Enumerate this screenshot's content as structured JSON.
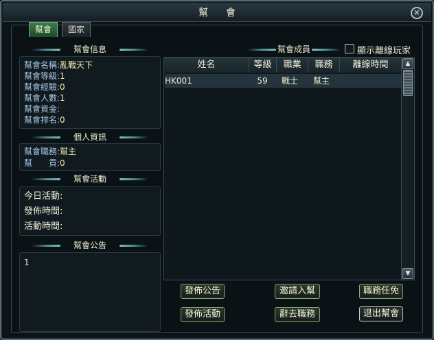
{
  "window": {
    "title": "幫會",
    "close_glyph": "✕"
  },
  "tabs": [
    {
      "label": "幫會",
      "active": true
    },
    {
      "label": "國家",
      "active": false
    }
  ],
  "guild_info": {
    "header": "幫會信息",
    "lines": [
      {
        "label": "幫會名稱:",
        "value": "亂戰天下"
      },
      {
        "label": "幫會等級:",
        "value": "1"
      },
      {
        "label": "幫會經驗:",
        "value": "0"
      },
      {
        "label": "幫會人數:",
        "value": "1"
      },
      {
        "label": "幫會資金:",
        "value": ""
      },
      {
        "label": "幫會排名:",
        "value": "0"
      }
    ]
  },
  "personal_info": {
    "header": "個人資訊",
    "lines": [
      {
        "label": "幫會職務:",
        "value": "幫主"
      },
      {
        "label": "幫　　貢:",
        "value": "0"
      }
    ]
  },
  "activity": {
    "header": "幫會活動",
    "lines": [
      {
        "label": "今日活動:"
      },
      {
        "label": "發佈時間:"
      },
      {
        "label": "活動時間:"
      }
    ]
  },
  "notice": {
    "header": "幫會公告",
    "text": "1"
  },
  "members": {
    "header": "幫會成員",
    "show_offline_label": "顯示離線玩家",
    "columns": [
      "姓名",
      "等級",
      "職業",
      "職務",
      "離線時間"
    ],
    "rows": [
      {
        "name": "HK001",
        "level": "59",
        "class": "戰士",
        "role": "幫主",
        "offline": ""
      }
    ]
  },
  "buttons": {
    "publish_notice": "發佈公告",
    "invite": "邀請入幫",
    "appoint": "職務任免",
    "publish_activity": "發佈活動",
    "resign": "辭去職務",
    "leave": "退出幫會"
  },
  "scroll": {
    "up": "▲",
    "down": "▼"
  }
}
